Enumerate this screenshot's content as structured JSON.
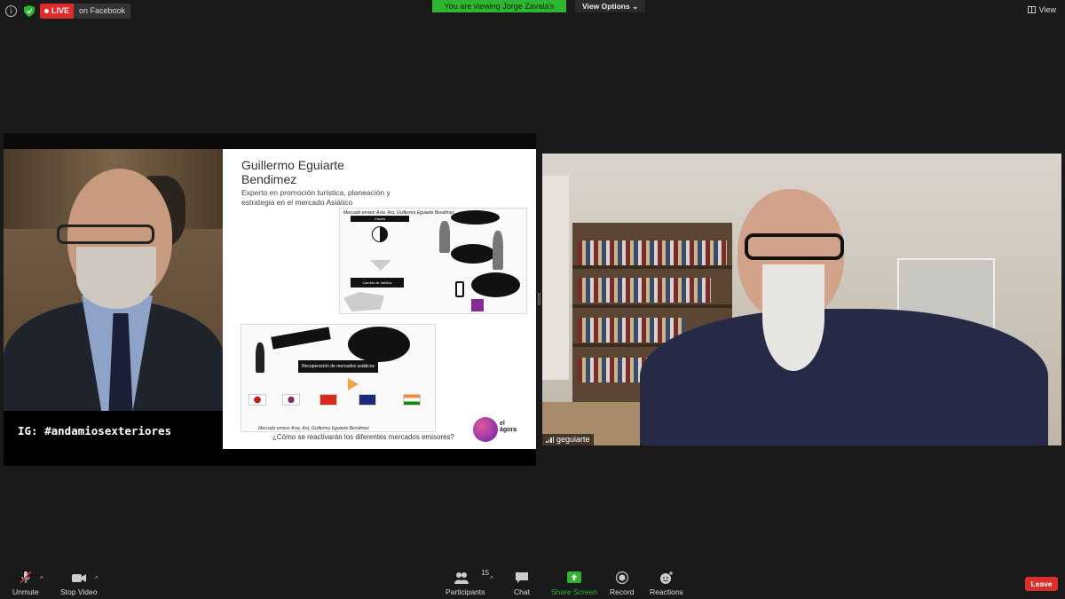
{
  "topbar": {
    "live_label": "LIVE",
    "platform": "on Facebook",
    "viewing_banner": "You are viewing Jorge Zavala's screen",
    "view_options": "View Options",
    "view_label": "View"
  },
  "share": {
    "ig_handle": "IG: #andamiosexteriores",
    "slide": {
      "title": "Guillermo Eguiarte Bendimez",
      "subtitle": "Experto en promoción turística, planeación y estrategia en el mercado Asiático",
      "card1_title": "Mercado emisor Asia. Arq. Guillermo Eguiarte Bendimez",
      "card1_box": "Claves",
      "card1_row": "Cambio de hábitos",
      "card2_box": "Recuperación de mercados asiáticos",
      "card2_credit": "Mercado emisor Asia. Arq. Guillermo Eguiarte Bendimez",
      "question": "¿Cómo se reactivarán los diferentes mercados emisores?",
      "logo_text_1": "el",
      "logo_text_2": "ágora"
    }
  },
  "speaker": {
    "name": "geguiarte"
  },
  "toolbar": {
    "unmute": "Unmute",
    "stop_video": "Stop Video",
    "participants": "Participants",
    "participants_count": "15",
    "chat": "Chat",
    "share_screen": "Share Screen",
    "record": "Record",
    "reactions": "Reactions",
    "leave": "Leave"
  },
  "colors": {
    "live_red": "#e02b2b",
    "banner_green": "#2fb52f",
    "leave_red": "#d9302c",
    "share_green": "#2fb52f"
  }
}
